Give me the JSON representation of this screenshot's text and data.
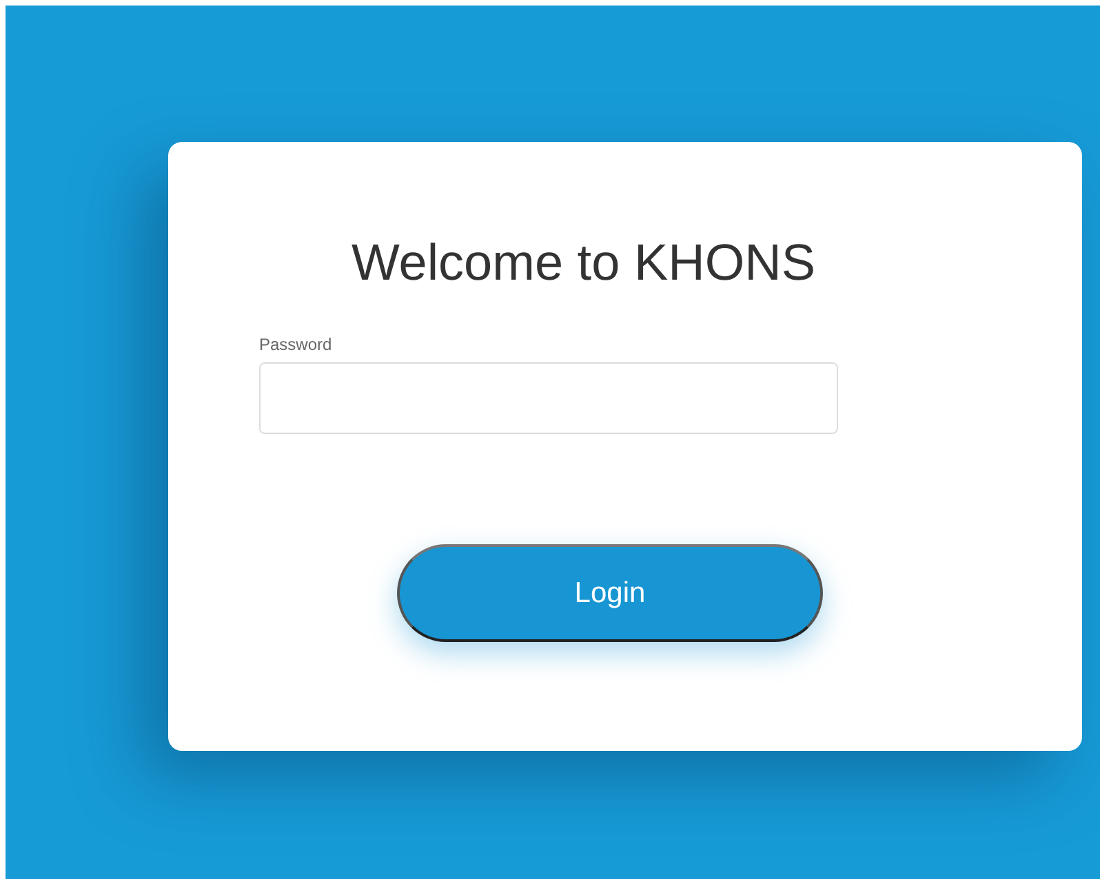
{
  "title": "Welcome to KHONS",
  "password_field": {
    "label": "Password"
  },
  "login_button": {
    "label": "Login"
  }
}
